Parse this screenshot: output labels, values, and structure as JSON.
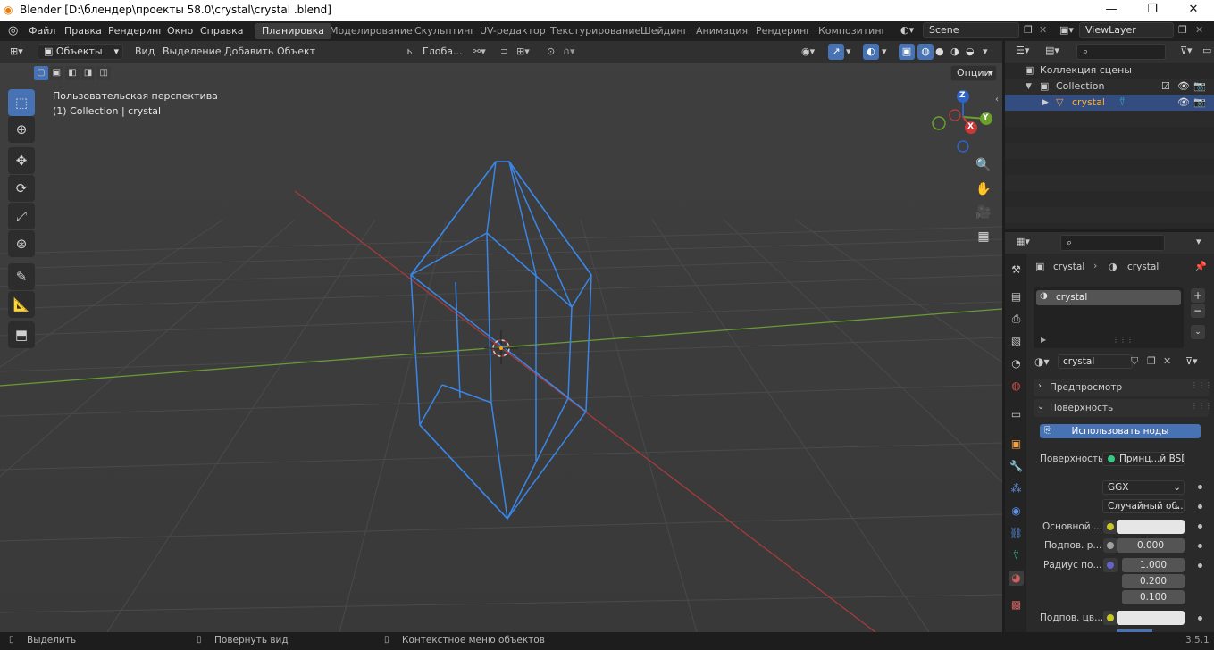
{
  "window": {
    "title": "Blender [D:\\блендер\\проекты 58.0\\crystal\\crystal .blend]",
    "minimize": "—",
    "maximize": "❐",
    "close": "✕"
  },
  "menu": [
    "Файл",
    "Правка",
    "Рендеринг",
    "Окно",
    "Справка"
  ],
  "workspaces": [
    {
      "label": "Планировка",
      "active": true
    },
    {
      "label": "Моделирование",
      "active": false
    },
    {
      "label": "Скульптинг",
      "active": false
    },
    {
      "label": "UV-редактор",
      "active": false
    },
    {
      "label": "Текстурирование",
      "active": false
    },
    {
      "label": "Шейдинг",
      "active": false
    },
    {
      "label": "Анимация",
      "active": false
    },
    {
      "label": "Рендеринг",
      "active": false
    },
    {
      "label": "Композитинг",
      "active": false
    }
  ],
  "scene": {
    "name": "Scene",
    "view_layer": "ViewLayer"
  },
  "viewport": {
    "mode": "Объекты",
    "menus": [
      "Вид",
      "Выделение",
      "Добавить",
      "Объект"
    ],
    "transform_orientation": "Глоба...",
    "options": "Опции",
    "info_line1": "Пользовательская перспектива",
    "info_line2": "(1) Collection | crystal",
    "gizmo": {
      "z": "Z",
      "y": "Y",
      "x": "X"
    }
  },
  "outliner": {
    "scene_collection": "Коллекция сцены",
    "collection": "Collection",
    "object": "crystal"
  },
  "properties": {
    "breadcrumb_object": "crystal",
    "breadcrumb_material": "crystal",
    "slot": "crystal",
    "material_name": "crystal",
    "panel_preview": "Предпросмотр",
    "panel_surface": "Поверхность",
    "use_nodes": "Использовать ноды",
    "surface_label": "Поверхность",
    "surface_shader": "Принц...й BSDF",
    "distribution": "GGX",
    "subsurface_method": "Случайный об...",
    "base_color_label": "Основной ...",
    "subsurface_label": "Подпов. р...",
    "subsurface_value": "0.000",
    "radius_label": "Радиус по...",
    "radius_values": [
      "1.000",
      "0.200",
      "0.100"
    ],
    "subsurface_color_label": "Подпов. цв..."
  },
  "status": {
    "select": "Выделить",
    "rotate": "Повернуть вид",
    "context": "Контекстное меню объектов",
    "version": "3.5.1"
  },
  "colors": {
    "accent": "#4772b3",
    "selection_wire": "#3a86e8",
    "x_axis": "#a83a3a",
    "y_axis": "#6a9a34"
  }
}
